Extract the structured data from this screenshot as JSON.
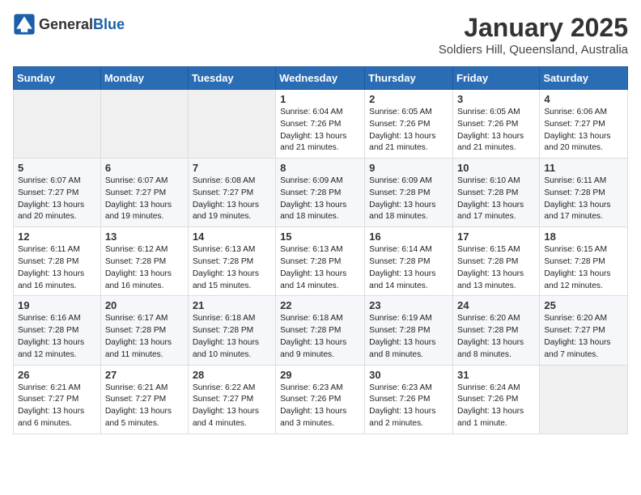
{
  "header": {
    "logo_general": "General",
    "logo_blue": "Blue",
    "month": "January 2025",
    "location": "Soldiers Hill, Queensland, Australia"
  },
  "weekdays": [
    "Sunday",
    "Monday",
    "Tuesday",
    "Wednesday",
    "Thursday",
    "Friday",
    "Saturday"
  ],
  "weeks": [
    [
      {
        "day": "",
        "info": ""
      },
      {
        "day": "",
        "info": ""
      },
      {
        "day": "",
        "info": ""
      },
      {
        "day": "1",
        "info": "Sunrise: 6:04 AM\nSunset: 7:26 PM\nDaylight: 13 hours and 21 minutes."
      },
      {
        "day": "2",
        "info": "Sunrise: 6:05 AM\nSunset: 7:26 PM\nDaylight: 13 hours and 21 minutes."
      },
      {
        "day": "3",
        "info": "Sunrise: 6:05 AM\nSunset: 7:26 PM\nDaylight: 13 hours and 21 minutes."
      },
      {
        "day": "4",
        "info": "Sunrise: 6:06 AM\nSunset: 7:27 PM\nDaylight: 13 hours and 20 minutes."
      }
    ],
    [
      {
        "day": "5",
        "info": "Sunrise: 6:07 AM\nSunset: 7:27 PM\nDaylight: 13 hours and 20 minutes."
      },
      {
        "day": "6",
        "info": "Sunrise: 6:07 AM\nSunset: 7:27 PM\nDaylight: 13 hours and 19 minutes."
      },
      {
        "day": "7",
        "info": "Sunrise: 6:08 AM\nSunset: 7:27 PM\nDaylight: 13 hours and 19 minutes."
      },
      {
        "day": "8",
        "info": "Sunrise: 6:09 AM\nSunset: 7:28 PM\nDaylight: 13 hours and 18 minutes."
      },
      {
        "day": "9",
        "info": "Sunrise: 6:09 AM\nSunset: 7:28 PM\nDaylight: 13 hours and 18 minutes."
      },
      {
        "day": "10",
        "info": "Sunrise: 6:10 AM\nSunset: 7:28 PM\nDaylight: 13 hours and 17 minutes."
      },
      {
        "day": "11",
        "info": "Sunrise: 6:11 AM\nSunset: 7:28 PM\nDaylight: 13 hours and 17 minutes."
      }
    ],
    [
      {
        "day": "12",
        "info": "Sunrise: 6:11 AM\nSunset: 7:28 PM\nDaylight: 13 hours and 16 minutes."
      },
      {
        "day": "13",
        "info": "Sunrise: 6:12 AM\nSunset: 7:28 PM\nDaylight: 13 hours and 16 minutes."
      },
      {
        "day": "14",
        "info": "Sunrise: 6:13 AM\nSunset: 7:28 PM\nDaylight: 13 hours and 15 minutes."
      },
      {
        "day": "15",
        "info": "Sunrise: 6:13 AM\nSunset: 7:28 PM\nDaylight: 13 hours and 14 minutes."
      },
      {
        "day": "16",
        "info": "Sunrise: 6:14 AM\nSunset: 7:28 PM\nDaylight: 13 hours and 14 minutes."
      },
      {
        "day": "17",
        "info": "Sunrise: 6:15 AM\nSunset: 7:28 PM\nDaylight: 13 hours and 13 minutes."
      },
      {
        "day": "18",
        "info": "Sunrise: 6:15 AM\nSunset: 7:28 PM\nDaylight: 13 hours and 12 minutes."
      }
    ],
    [
      {
        "day": "19",
        "info": "Sunrise: 6:16 AM\nSunset: 7:28 PM\nDaylight: 13 hours and 12 minutes."
      },
      {
        "day": "20",
        "info": "Sunrise: 6:17 AM\nSunset: 7:28 PM\nDaylight: 13 hours and 11 minutes."
      },
      {
        "day": "21",
        "info": "Sunrise: 6:18 AM\nSunset: 7:28 PM\nDaylight: 13 hours and 10 minutes."
      },
      {
        "day": "22",
        "info": "Sunrise: 6:18 AM\nSunset: 7:28 PM\nDaylight: 13 hours and 9 minutes."
      },
      {
        "day": "23",
        "info": "Sunrise: 6:19 AM\nSunset: 7:28 PM\nDaylight: 13 hours and 8 minutes."
      },
      {
        "day": "24",
        "info": "Sunrise: 6:20 AM\nSunset: 7:28 PM\nDaylight: 13 hours and 8 minutes."
      },
      {
        "day": "25",
        "info": "Sunrise: 6:20 AM\nSunset: 7:27 PM\nDaylight: 13 hours and 7 minutes."
      }
    ],
    [
      {
        "day": "26",
        "info": "Sunrise: 6:21 AM\nSunset: 7:27 PM\nDaylight: 13 hours and 6 minutes."
      },
      {
        "day": "27",
        "info": "Sunrise: 6:21 AM\nSunset: 7:27 PM\nDaylight: 13 hours and 5 minutes."
      },
      {
        "day": "28",
        "info": "Sunrise: 6:22 AM\nSunset: 7:27 PM\nDaylight: 13 hours and 4 minutes."
      },
      {
        "day": "29",
        "info": "Sunrise: 6:23 AM\nSunset: 7:26 PM\nDaylight: 13 hours and 3 minutes."
      },
      {
        "day": "30",
        "info": "Sunrise: 6:23 AM\nSunset: 7:26 PM\nDaylight: 13 hours and 2 minutes."
      },
      {
        "day": "31",
        "info": "Sunrise: 6:24 AM\nSunset: 7:26 PM\nDaylight: 13 hours and 1 minute."
      },
      {
        "day": "",
        "info": ""
      }
    ]
  ]
}
